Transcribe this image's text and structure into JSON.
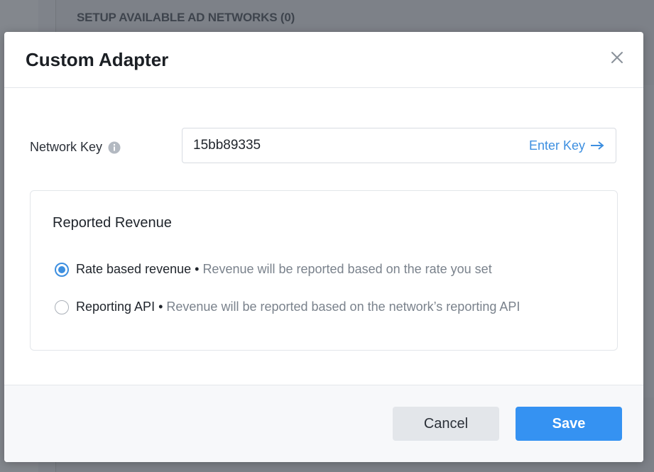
{
  "background": {
    "section_header": "SETUP AVAILABLE AD NETWORKS (0)"
  },
  "modal": {
    "title": "Custom Adapter",
    "close_icon": "close-icon",
    "network_key": {
      "label": "Network Key",
      "info_icon": "info-icon",
      "value": "15bb89335",
      "action_label": "Enter Key",
      "action_icon": "arrow-right-icon"
    },
    "reported_revenue": {
      "title": "Reported Revenue",
      "options": [
        {
          "name": "Rate based revenue",
          "separator": "•",
          "description": "Revenue will be reported based on the rate you set",
          "selected": true
        },
        {
          "name": "Reporting API",
          "separator": "•",
          "description": "Revenue will be reported based on the network’s reporting API",
          "selected": false
        }
      ]
    },
    "footer": {
      "cancel_label": "Cancel",
      "save_label": "Save"
    }
  },
  "colors": {
    "accent": "#3592f2",
    "link": "#3d8fe0",
    "overlay": "#7d8188"
  }
}
